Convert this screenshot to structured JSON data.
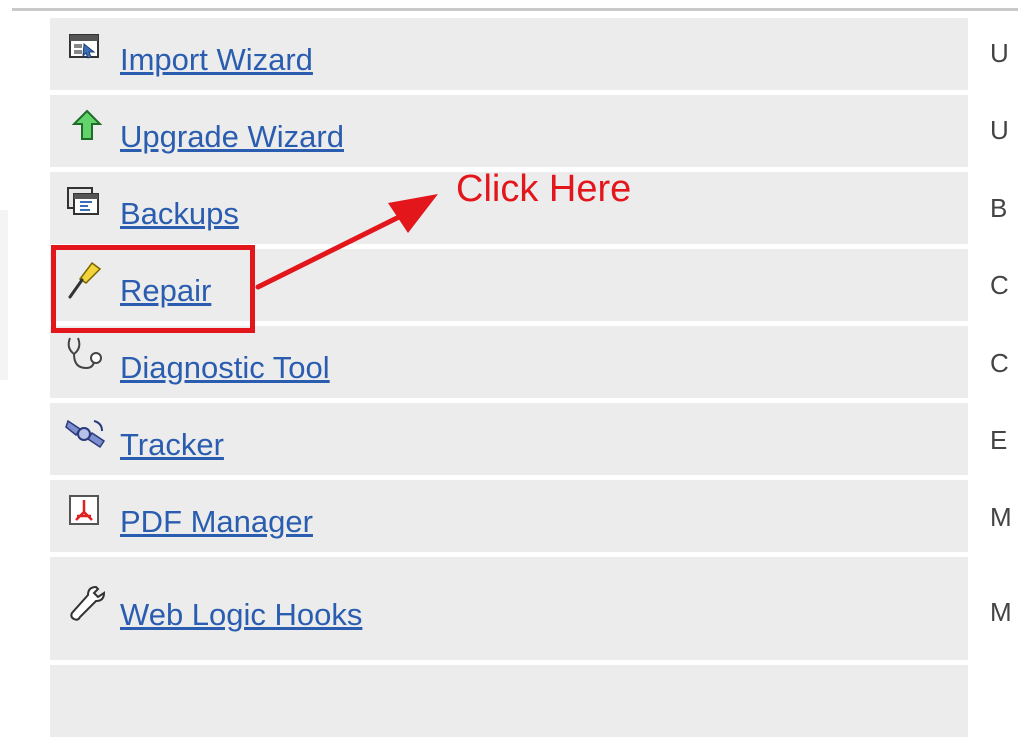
{
  "rows": [
    {
      "label": "Import Wizard",
      "icon": "import-wizard-icon",
      "desc": "U"
    },
    {
      "label": "Upgrade Wizard",
      "icon": "upgrade-arrow-icon",
      "desc": "U"
    },
    {
      "label": "Backups",
      "icon": "backups-icon",
      "desc": "B"
    },
    {
      "label": "Repair",
      "icon": "screwdriver-icon",
      "desc": "C"
    },
    {
      "label": "Diagnostic Tool",
      "icon": "stethoscope-icon",
      "desc": "C"
    },
    {
      "label": "Tracker",
      "icon": "satellite-icon",
      "desc": "E"
    },
    {
      "label": "PDF Manager",
      "icon": "pdf-icon",
      "desc": "M"
    },
    {
      "label": "Web Logic Hooks",
      "icon": "wrench-icon",
      "desc": "M"
    }
  ],
  "annotation": {
    "text": "Click Here",
    "color": "#e3161c"
  },
  "colors": {
    "row_bg": "#ececec",
    "link": "#2a5db0"
  }
}
